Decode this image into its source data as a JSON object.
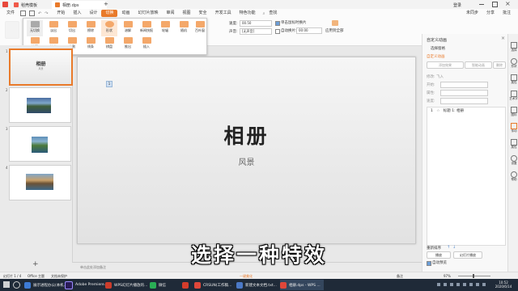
{
  "titlebar": {
    "tabs": [
      {
        "label": "稻壳模板"
      },
      {
        "label": "相册.dps"
      }
    ],
    "add_tab": "+",
    "login": "登录"
  },
  "menubar": {
    "file": "文件",
    "items": [
      "开始",
      "插入",
      "设计",
      "切换",
      "动画",
      "幻灯片放映",
      "审阅",
      "视图",
      "安全",
      "开发工具",
      "特色功能"
    ],
    "active": "切换",
    "search": "查找",
    "right_items": [
      "未同步",
      "分享",
      "批注"
    ]
  },
  "ribbon": {
    "speed_label": "速度:",
    "speed_value": "00.50",
    "sound_label": "声音:",
    "sound_value": "[无声音]",
    "click_advance": "单击鼠标时换片",
    "auto_advance": "自动换片:",
    "auto_value": "00:00",
    "apply_all": "应用到全部"
  },
  "effects": {
    "row1": [
      "无切换",
      "淡出",
      "切出",
      "擦除",
      "形状",
      "溶解",
      "新闻快报",
      "轮辐",
      "随机",
      "百叶窗"
    ],
    "row2": [
      "梳理",
      "抽出",
      "分割",
      "线条",
      "棋盘",
      "推出",
      "插入"
    ],
    "selected": "形状"
  },
  "slides": {
    "thumb_numbers": [
      "1",
      "2",
      "3",
      "4"
    ],
    "thumb1_title": "相册",
    "thumb1_subtitle": "风景",
    "add_slide": "+"
  },
  "canvas": {
    "title": "相册",
    "subtitle": "风景",
    "placeholder_tag": "1",
    "notes": "单击此处添加备注"
  },
  "right_panel": {
    "header": "自定义动画",
    "select_pane": "选择窗格",
    "section": "自定义动画",
    "add_effect": "添加效果",
    "smart_anim": "智能动画",
    "delete": "删除",
    "modify": "修改: 飞入",
    "start_label": "开始:",
    "property_label": "属性:",
    "speed_label": "速度:",
    "list_item_num": "1",
    "list_item": "标题 1: 相册",
    "reorder_label": "重新排序",
    "play": "播放",
    "slideshow": "幻灯片播放",
    "auto_preview": "自动预览"
  },
  "right_bar": {
    "items": [
      "选择",
      "形状",
      "属性",
      "艺术字",
      "图标",
      "传动",
      "属性",
      "设置",
      "帮助"
    ]
  },
  "statusbar": {
    "slide_info": "幻灯片 1 / 4",
    "theme": "Office 主题",
    "backup": "文档未保护",
    "notes": "备注",
    "zoom": "97%",
    "fit": "一键美化"
  },
  "taskbar": {
    "apps": [
      {
        "label": "展示进程办公(本机...",
        "color": "#3d7bd6"
      },
      {
        "label": "Adobe Premiere...",
        "color": "#2a1c58"
      },
      {
        "label": "WPS幻灯片播放的...",
        "color": "#cc3c2b"
      },
      {
        "label": "微信",
        "color": "#2aae55"
      },
      {
        "label": "",
        "color": "#d43c2b"
      },
      {
        "label": "CRSUN(工作稿...",
        "color": "#e0473a"
      },
      {
        "label": "新建文本文档.txt...",
        "color": "#4b79c7"
      },
      {
        "label": "相册.dps - WPS ...",
        "color": "#e0473a"
      }
    ],
    "clock_time": "10:52",
    "clock_date": "2020/6/14"
  },
  "overlay_subtitle": "选择一种特效",
  "colors": {
    "accent": "#e97a2a",
    "taskbar": "#1f2a38"
  }
}
